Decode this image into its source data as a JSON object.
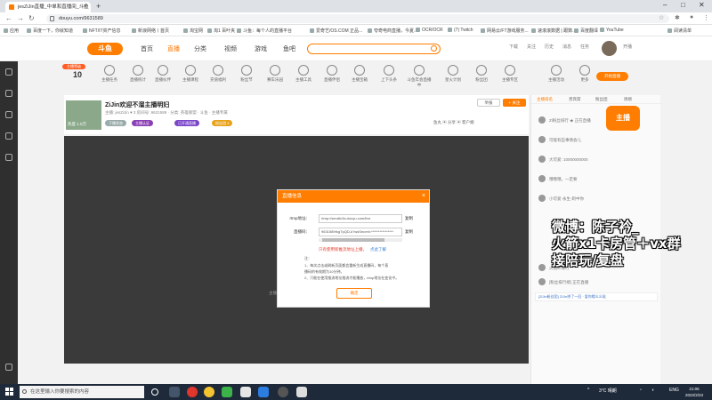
{
  "browser": {
    "tab_title": "jesZiJin直播_中单和直播间_斗鱼",
    "url": "douyu.com/9631589",
    "bookmarks": [
      "应用",
      "百度一下，你就知道",
      "NFT/IT资产信息",
      "新浪网络丨首页",
      "淘宝网",
      "淘1 百叶夹",
      "斗鱼：每个人的直播平台",
      "爱奇艺/OS.COM 正品...",
      "夸奇电商直播，今夏...",
      "OCR/OCR",
      "(7) Twitch",
      "网易云/FT游戏服务...",
      "速滚滚数据 | 跟数...",
      "百度翻译",
      "YouTube",
      "阅读清单"
    ]
  },
  "site": {
    "logo_text": "斗鱼",
    "nav": [
      "首页",
      "直播",
      "分类",
      "视频",
      "游戏",
      "鱼吧"
    ],
    "header_icons": [
      "下载",
      "关注",
      "历史",
      "消息",
      "任务",
      "开播"
    ]
  },
  "toolbar": {
    "level_badge": "主播等级",
    "level_value": "10",
    "items": [
      "主播任务",
      "直播统计",
      "直播伙伴",
      "主播课程",
      "充值福利",
      "粉丝节",
      "赛车乐园",
      "主播工具",
      "直播伴侣",
      "主播宝箱",
      "上下头条",
      "斗鱼年会直播中",
      "星火计划",
      "粉丝团",
      "主播专区",
      "主播活动",
      "更多"
    ],
    "start_btn": "开始直播"
  },
  "streamer": {
    "title": "ZiJin欢迎不溜主播明妇",
    "meta": "主播: jesZiJin  ♥ 3  房间号: 9631589 · 分类: 英雄联盟 · 斗鱼 · 主播专属",
    "thumb_label": "热度 1.0万",
    "chips": [
      "下播状态",
      "主播认证",
      "已开通直播",
      "粉丝团 3"
    ],
    "follow": "+ 关注",
    "report": "举报",
    "gifts": "鱼丸  ▣ 分享  ▣ 客户端"
  },
  "video": {
    "note": "主播正在直播中，请稍后重试"
  },
  "dialog": {
    "title": "直播信息",
    "rtmp_label": "rtmp地址：",
    "rtmp_value": "rtmp://sendtc3a.douyu.com/live",
    "code_label": "直播码：",
    "code_value": "9631589rkgTpQD-k?wsSecret=****************",
    "copy": "复制",
    "warn": "只有使用新推流地址上播，",
    "help": "点此了解",
    "notes": [
      "注：",
      "1、每次点击或刷新页面都会重新生成直播码，每个直",
      "    播码的有效期为10分钟。",
      "2、只能在使用推流地址推流才能播放，rtmp地址在变化中。"
    ],
    "confirm": "确定"
  },
  "chat": {
    "tabs": [
      "主播排名",
      "贵宾席",
      "粉丝团",
      "周榜"
    ],
    "badge": "主播",
    "lines": [
      "Zi粉丝排行 ★ 正在直播",
      "可能有些事情会儿",
      "大可爱: 10000000000",
      "哦哦哦，一定要",
      "小可爱·永生·刺中你",
      "火焰杯排行",
      "[粉丝排行榜] 正在直播"
    ],
    "bottom": "[ZiJin粉丝团] ZiJin拼了一回 · 爱你哦么么哒"
  },
  "overlay_text": [
    "微博：陈子衿_",
    "火箭x1卡房管＋vx群",
    "接陪玩/复盘"
  ],
  "taskbar": {
    "search_placeholder": "在这里输入你要搜索的内容",
    "weather": "3°C 晴朗",
    "lang": "ENG",
    "time": "21:06",
    "date": "2022/2/23"
  },
  "colors": {
    "accent": "#ff7d00",
    "dark": "#2f2f2f"
  }
}
